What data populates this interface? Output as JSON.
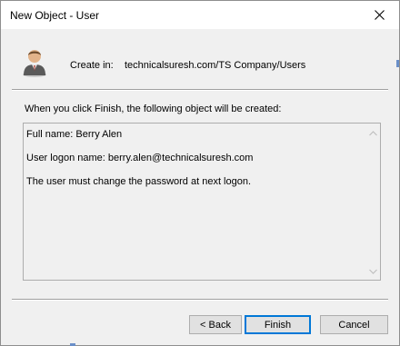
{
  "window": {
    "title": "New Object - User",
    "close_icon": "close-icon"
  },
  "header": {
    "icon": "user-icon",
    "create_in_label": "Create in:",
    "create_in_value": "technicalsuresh.com/TS Company/Users"
  },
  "summary": {
    "intro": "When you click Finish, the following object will be created:",
    "lines": [
      "Full name: Berry Alen",
      "User logon name: berry.alen@technicalsuresh.com",
      "The user must change the password at next logon."
    ]
  },
  "buttons": {
    "back": "< Back",
    "finish": "Finish",
    "cancel": "Cancel"
  },
  "colors": {
    "accent": "#0078d7",
    "dialog_bg": "#f0f0f0"
  }
}
